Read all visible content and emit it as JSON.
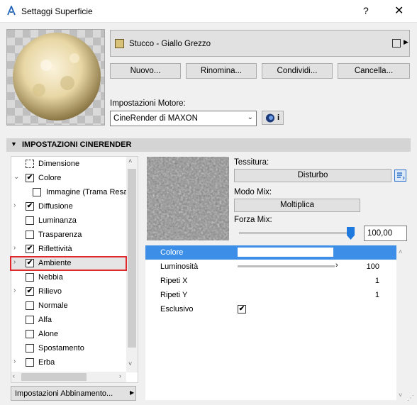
{
  "window": {
    "title": "Settaggi Superficie",
    "help": "?",
    "close": "✕"
  },
  "material": {
    "name": "Stucco - Giallo Grezzo",
    "swatch_color": "#d8c27a"
  },
  "buttons": {
    "new": "Nuovo...",
    "rename": "Rinomina...",
    "share": "Condividi...",
    "delete": "Cancella..."
  },
  "engine": {
    "label": "Impostazioni Motore:",
    "value": "CineRender di MAXON",
    "info": "i"
  },
  "section": {
    "title": "IMPOSTAZIONI CINERENDER"
  },
  "tree": [
    {
      "label": "Dimensione",
      "type": "icon",
      "expand": ""
    },
    {
      "label": "Colore",
      "type": "check",
      "checked": "✔",
      "expand": "⌄"
    },
    {
      "label": "Immagine (Trama Resa",
      "type": "image",
      "expand": ""
    },
    {
      "label": "Diffusione",
      "type": "check",
      "checked": "✔",
      "expand": "›"
    },
    {
      "label": "Luminanza",
      "type": "check",
      "checked": "",
      "expand": ""
    },
    {
      "label": "Trasparenza",
      "type": "check",
      "checked": "",
      "expand": ""
    },
    {
      "label": "Riflettività",
      "type": "check",
      "checked": "✔",
      "expand": "›"
    },
    {
      "label": "Ambiente",
      "type": "check",
      "checked": "✔",
      "expand": "›"
    },
    {
      "label": "Nebbia",
      "type": "check",
      "checked": "",
      "expand": ""
    },
    {
      "label": "Rilievo",
      "type": "check",
      "checked": "✔",
      "expand": "›"
    },
    {
      "label": "Normale",
      "type": "check",
      "checked": "",
      "expand": ""
    },
    {
      "label": "Alfa",
      "type": "check",
      "checked": "",
      "expand": ""
    },
    {
      "label": "Alone",
      "type": "check",
      "checked": "",
      "expand": ""
    },
    {
      "label": "Spostamento",
      "type": "check",
      "checked": "",
      "expand": ""
    },
    {
      "label": "Erba",
      "type": "check",
      "checked": "",
      "expand": "›"
    }
  ],
  "bottom_dropdown": {
    "label": "Impostazioni Abbinamento..."
  },
  "texture": {
    "label": "Tessitura:",
    "value": "Disturbo"
  },
  "mix": {
    "label": "Modo Mix:",
    "value": "Moltiplica",
    "strength_label": "Forza Mix:",
    "strength_value": "100,00",
    "strength_fraction": 1.0
  },
  "properties": [
    {
      "label": "Colore",
      "value": "",
      "selected": true
    },
    {
      "label": "Luminosità",
      "value": "100"
    },
    {
      "label": "Ripeti X",
      "value": "1"
    },
    {
      "label": "Ripeti Y",
      "value": "1"
    },
    {
      "label": "Esclusivo",
      "value": "✔"
    }
  ],
  "colors": {
    "accent": "#3d8ee6",
    "highlight": "#e0282c"
  }
}
